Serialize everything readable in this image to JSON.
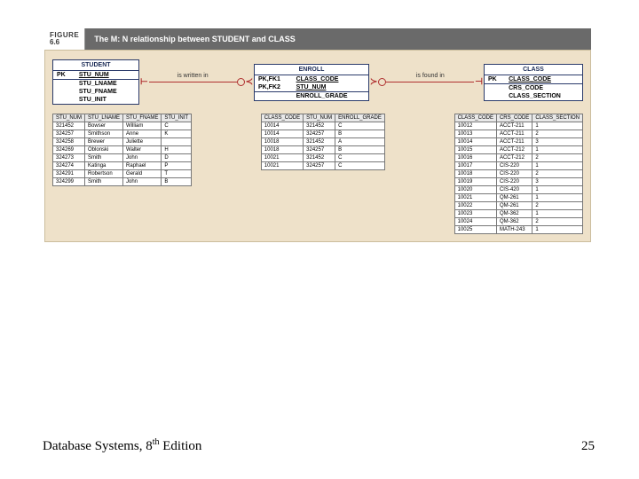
{
  "figure": {
    "label_top": "FIGURE",
    "number": "6.6",
    "title": "The M: N relationship between STUDENT and CLASS"
  },
  "entities": {
    "student": {
      "name": "STUDENT",
      "rows": [
        [
          "PK",
          "STU_NUM"
        ],
        [
          "",
          "STU_LNAME"
        ],
        [
          "",
          "STU_FNAME"
        ],
        [
          "",
          "STU_INIT"
        ]
      ],
      "divider_after": 0
    },
    "enroll": {
      "name": "ENROLL",
      "rows": [
        [
          "PK,FK1",
          "CLASS_CODE"
        ],
        [
          "PK,FK2",
          "STU_NUM"
        ],
        [
          "",
          "ENROLL_GRADE"
        ]
      ],
      "divider_after": 1
    },
    "class": {
      "name": "CLASS",
      "rows": [
        [
          "PK",
          "CLASS_CODE"
        ],
        [
          "",
          "CRS_CODE"
        ],
        [
          "",
          "CLASS_SECTION"
        ]
      ],
      "divider_after": 0
    }
  },
  "rel": {
    "left": "is written in",
    "right": "is found in"
  },
  "student_table": {
    "headers": [
      "STU_NUM",
      "STU_LNAME",
      "STU_FNAME",
      "STU_INIT"
    ],
    "rows": [
      [
        "321452",
        "Bowser",
        "William",
        "C"
      ],
      [
        "324257",
        "Smithson",
        "Anne",
        "K"
      ],
      [
        "324258",
        "Brewer",
        "Juliette",
        ""
      ],
      [
        "324269",
        "Oblonski",
        "Walter",
        "H"
      ],
      [
        "324273",
        "Smith",
        "John",
        "D"
      ],
      [
        "324274",
        "Katinga",
        "Raphael",
        "P"
      ],
      [
        "324291",
        "Robertson",
        "Gerald",
        "T"
      ],
      [
        "324299",
        "Smith",
        "John",
        "B"
      ]
    ]
  },
  "enroll_table": {
    "headers": [
      "CLASS_CODE",
      "STU_NUM",
      "ENROLL_GRADE"
    ],
    "rows": [
      [
        "10014",
        "321452",
        "C"
      ],
      [
        "10014",
        "324257",
        "B"
      ],
      [
        "10018",
        "321452",
        "A"
      ],
      [
        "10018",
        "324257",
        "B"
      ],
      [
        "10021",
        "321452",
        "C"
      ],
      [
        "10021",
        "324257",
        "C"
      ]
    ]
  },
  "class_table": {
    "headers": [
      "CLASS_CODE",
      "CRS_CODE",
      "CLASS_SECTION"
    ],
    "rows": [
      [
        "10012",
        "ACCT-211",
        "1"
      ],
      [
        "10013",
        "ACCT-211",
        "2"
      ],
      [
        "10014",
        "ACCT-211",
        "3"
      ],
      [
        "10015",
        "ACCT-212",
        "1"
      ],
      [
        "10016",
        "ACCT-212",
        "2"
      ],
      [
        "10017",
        "CIS-220",
        "1"
      ],
      [
        "10018",
        "CIS-220",
        "2"
      ],
      [
        "10019",
        "CIS-220",
        "3"
      ],
      [
        "10020",
        "CIS-420",
        "1"
      ],
      [
        "10021",
        "QM-261",
        "1"
      ],
      [
        "10022",
        "QM-261",
        "2"
      ],
      [
        "10023",
        "QM-362",
        "1"
      ],
      [
        "10024",
        "QM-362",
        "2"
      ],
      [
        "10025",
        "MATH-243",
        "1"
      ]
    ]
  },
  "footer": {
    "text_a": "Database Systems, 8",
    "text_b": " Edition",
    "sup": "th",
    "page": "25"
  }
}
